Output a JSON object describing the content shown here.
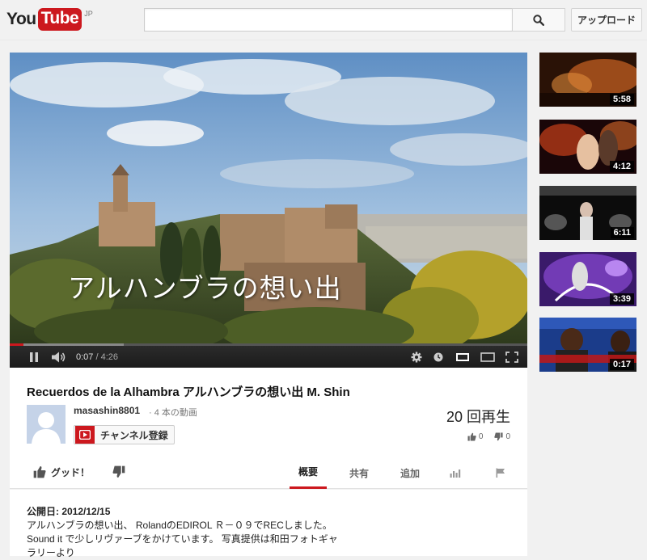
{
  "header": {
    "logo_you": "You",
    "logo_tube": "Tube",
    "logo_country": "JP",
    "search_placeholder": "",
    "search_value": "",
    "upload_label": "アップロード"
  },
  "player": {
    "overlay_text": "アルハンブラの想い出",
    "time_current": "0:07",
    "time_separator": " / ",
    "time_total": "4:26",
    "progress_played_fraction": 0.027,
    "progress_loaded_fraction": 0.22
  },
  "video": {
    "title": "Recuerdos de la Alhambra アルハンブラの想い出 M. Shin",
    "channel_name": "masashin8801",
    "video_count": "· 4 本の動画",
    "subscribe_label": "チャンネル登録",
    "view_count": "20 回再生",
    "likes": "0",
    "dislikes": "0",
    "like_label": "グッド！"
  },
  "tabs": [
    {
      "label": "概要",
      "active": true
    },
    {
      "label": "共有",
      "active": false
    },
    {
      "label": "追加",
      "active": false
    }
  ],
  "description": {
    "published": "公開日: 2012/12/15",
    "line1": "アルハンブラの想い出、 RolandのEDIROL Ｒ－０９でRECしました。",
    "line2": "Sound it で少しリヴァーブをかけています。  写真提供は和田フォトギャ",
    "line3": "ラリーより"
  },
  "sidebar": {
    "videos": [
      {
        "duration": "5:58"
      },
      {
        "duration": "4:12"
      },
      {
        "duration": "6:11"
      },
      {
        "duration": "3:39"
      },
      {
        "duration": "0:17"
      }
    ]
  },
  "icons": {
    "search": "magnifier-icon",
    "play_pause": "pause-icon",
    "volume": "volume-icon",
    "settings": "gear-icon",
    "watch_later": "clock-icon",
    "small_player": "small-player-icon",
    "large_player": "large-player-icon",
    "fullscreen": "fullscreen-icon"
  },
  "colors": {
    "brand_red": "#cc181e",
    "background": "#f1f1f1"
  }
}
